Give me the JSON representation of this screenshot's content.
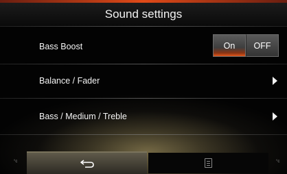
{
  "header": {
    "title": "Sound settings"
  },
  "rows": [
    {
      "label": "Bass Boost"
    },
    {
      "label": "Balance / Fader"
    },
    {
      "label": "Bass / Medium / Treble"
    }
  ],
  "bass_boost_toggle": {
    "on_label": "On",
    "off_label": "OFF",
    "selected": "On"
  },
  "bottom_bar": {
    "left_temp": "°c",
    "right_temp": "°c",
    "back_icon": "back-arrow-icon",
    "menu_icon": "menu-list-icon"
  },
  "colors": {
    "accent": "#e04a18",
    "text": "#ffffff",
    "background": "#030303"
  }
}
